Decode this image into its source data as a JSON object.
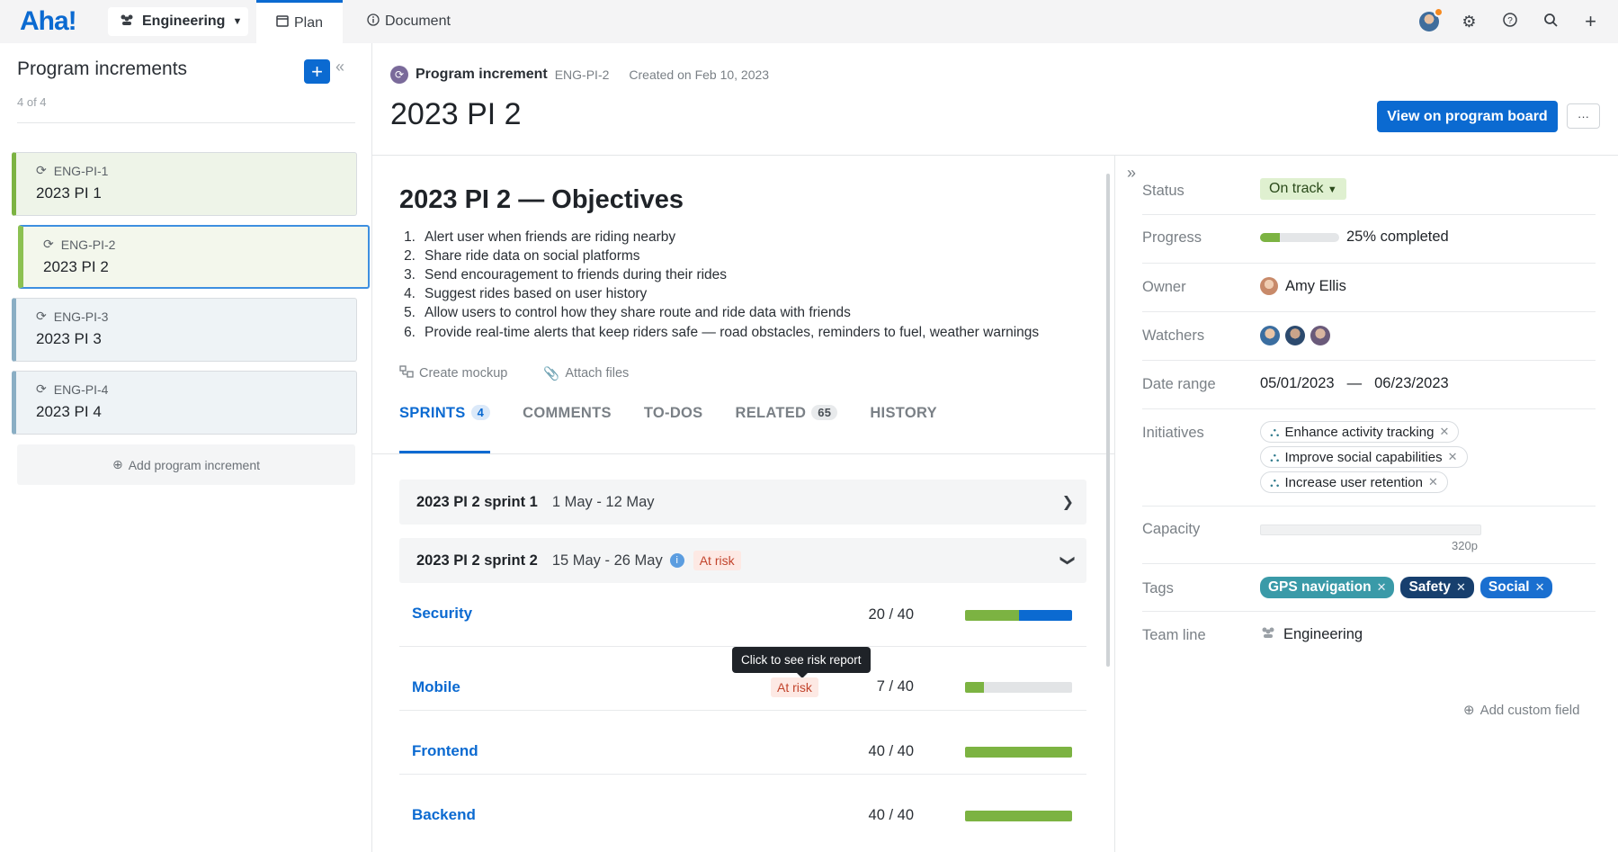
{
  "topbar": {
    "logo": "Aha!",
    "workspace": "Engineering",
    "tabs": [
      {
        "label": "Plan"
      },
      {
        "label": "Document"
      }
    ]
  },
  "sidebar": {
    "title": "Program increments",
    "count": "4 of 4",
    "add_label": "Add program increment",
    "items": [
      {
        "id": "ENG-PI-1",
        "name": "2023 PI 1"
      },
      {
        "id": "ENG-PI-2",
        "name": "2023 PI 2"
      },
      {
        "id": "ENG-PI-3",
        "name": "2023 PI 3"
      },
      {
        "id": "ENG-PI-4",
        "name": "2023 PI 4"
      }
    ]
  },
  "record": {
    "type_label": "Program increment",
    "id": "ENG-PI-2",
    "created": "Created on Feb 10, 2023",
    "title": "2023 PI 2",
    "view_board": "View on program board",
    "more": "···"
  },
  "objectives": {
    "title": "2023 PI 2 — Objectives",
    "items": [
      {
        "num": "1.",
        "text": "Alert user when friends are riding nearby"
      },
      {
        "num": "2.",
        "text": "Share ride data on social platforms"
      },
      {
        "num": "3.",
        "text": "Send encouragement to friends during their rides"
      },
      {
        "num": "4.",
        "text": "Suggest rides based on user history"
      },
      {
        "num": "5.",
        "text": "Allow users to control how they share route and ride data with friends"
      },
      {
        "num": "6.",
        "text": "Provide real-time alerts that keep riders safe — road obstacles, reminders to fuel, weather warnings"
      }
    ]
  },
  "actions": {
    "create_mockup": "Create mockup",
    "attach_files": "Attach files"
  },
  "tabs": [
    {
      "label": "SPRINTS",
      "badge": "4"
    },
    {
      "label": "COMMENTS"
    },
    {
      "label": "TO-DOS"
    },
    {
      "label": "RELATED",
      "badge": "65"
    },
    {
      "label": "HISTORY"
    }
  ],
  "sprints": [
    {
      "name": "2023 PI 2 sprint 1",
      "dates": "1 May - 12 May"
    },
    {
      "name": "2023 PI 2 sprint 2",
      "dates": "15 May - 26 May",
      "risk": "At risk"
    }
  ],
  "teams": [
    {
      "name": "Security",
      "count": "20 / 40",
      "green": 0.5,
      "blue": 0.5
    },
    {
      "name": "Mobile",
      "count": "7 / 40",
      "green": 0.18,
      "blue": 0,
      "risk": "At risk",
      "tooltip": "Click to see risk report"
    },
    {
      "name": "Frontend",
      "count": "40 / 40",
      "green": 1,
      "blue": 0
    },
    {
      "name": "Backend",
      "count": "40 / 40",
      "green": 1,
      "blue": 0
    }
  ],
  "details": {
    "status": {
      "label": "Status",
      "value": "On track"
    },
    "progress": {
      "label": "Progress",
      "value": "25% completed",
      "fraction": 0.25
    },
    "owner": {
      "label": "Owner",
      "value": "Amy Ellis"
    },
    "watchers": {
      "label": "Watchers"
    },
    "date_range": {
      "label": "Date range",
      "start": "05/01/2023",
      "sep": "—",
      "end": "06/23/2023"
    },
    "initiatives": {
      "label": "Initiatives",
      "items": [
        "Enhance activity tracking",
        "Improve social capabilities",
        "Increase user retention"
      ]
    },
    "capacity": {
      "label": "Capacity",
      "value": "320p"
    },
    "tags": {
      "label": "Tags",
      "items": [
        {
          "name": "GPS navigation",
          "color": "#3a9aa8"
        },
        {
          "name": "Safety",
          "color": "#173f6e"
        },
        {
          "name": "Social",
          "color": "#1a6fd0"
        }
      ]
    },
    "team_line": {
      "label": "Team line",
      "value": "Engineering"
    },
    "add_field": "Add custom field"
  }
}
